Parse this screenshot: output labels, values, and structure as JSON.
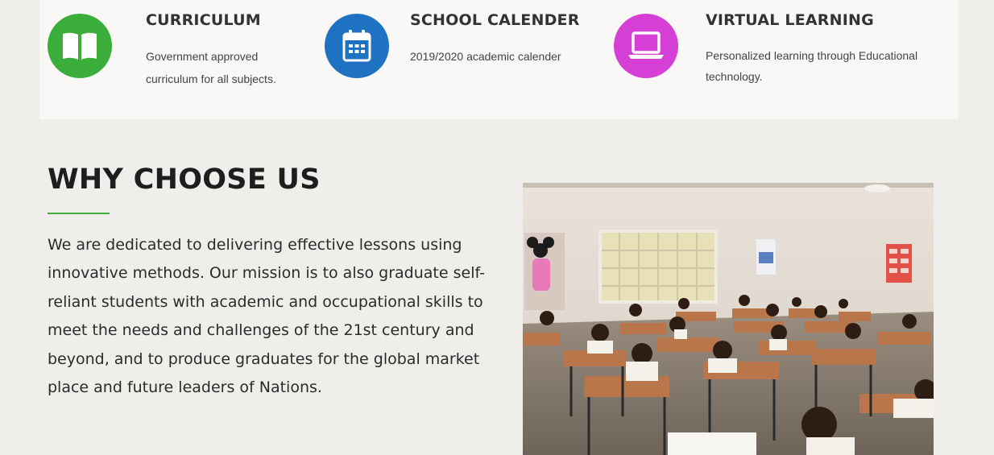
{
  "features": [
    {
      "title": "CURRICULUM",
      "description": "Government approved curriculum for all subjects.",
      "icon": "book-icon",
      "color": "#3aad3a"
    },
    {
      "title": "SCHOOL CALENDER",
      "description": "2019/2020 academic calender",
      "icon": "calendar-icon",
      "color": "#1f72c1"
    },
    {
      "title": "VIRTUAL LEARNING",
      "description": "Personalized learning through Educational technology.",
      "icon": "laptop-icon",
      "color": "#d63fd6"
    }
  ],
  "why": {
    "heading": "WHY CHOOSE US",
    "text": "We are dedicated to delivering effective lessons using innovative methods. Our mission is to also graduate self-reliant students with academic and occupational skills to meet the needs and challenges of the 21st century and beyond, and to produce graduates for the global market place and future leaders of Nations.",
    "accent_color": "#3aad3a"
  }
}
